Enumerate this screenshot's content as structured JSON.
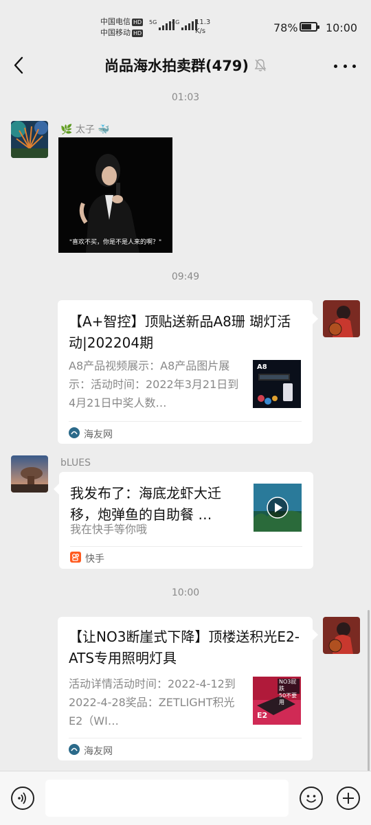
{
  "status": {
    "carrier1": "中国电信",
    "carrier2": "中国移动",
    "hd": "HD",
    "net1": "5G",
    "net2": "4G",
    "speed_value": "11.3",
    "speed_unit": "K/s",
    "battery": "78%",
    "battery_level": 0.78,
    "time": "10:00"
  },
  "nav": {
    "title": "尚品海水拍卖群(479)"
  },
  "messages": [
    {
      "time": "01:03"
    },
    {
      "sender": "太子",
      "sender_prefix_emoji": "🌿",
      "sender_suffix_emoji": "🐳",
      "image_caption": "\"喜欢不买，你是不是人来的啊？\""
    },
    {
      "time": "09:49"
    },
    {
      "title": "【A+智控】顶贴送新品A8珊 瑚灯活动|202204期",
      "desc": "A8产品视频展示：A8产品图片展示：活动时间：2022年3月21日到4月21日中奖人数…",
      "source": "海友网",
      "thumb_label": "A8"
    },
    {
      "sender": "bLUES",
      "title": "我发布了：海底龙虾大迁移，炮弹鱼的自助餐 …",
      "desc": "我在快手等你哦",
      "source": "快手"
    },
    {
      "time": "10:00"
    },
    {
      "title": "【让NO3断崖式下降】顶楼送积光E2-ATS专用照明灯具",
      "desc": "活动详情活动时间：2022-4-12到2022-4-28奖品：ZETLIGHT积光E2（WI…",
      "source": "海友网",
      "thumb_label1": "NO3屁跌",
      "thumb_label2": "50不要用",
      "thumb_label3": "E2"
    }
  ]
}
